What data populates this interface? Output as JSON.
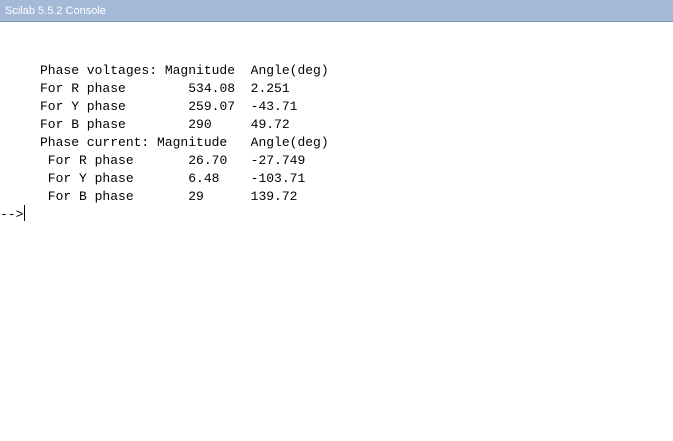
{
  "window": {
    "title": "Scilab 5.5.2 Console"
  },
  "console": {
    "lines": [
      [
        "Phase voltages: Magnitude",
        "  Angle(deg)"
      ],
      [
        "For R phase",
        "        534.08",
        "  2.251"
      ],
      [
        "For Y phase",
        "        259.07",
        "  -43.71"
      ],
      [
        "For B phase",
        "        290",
        "     49.72"
      ],
      [
        "Phase current: Magnitude",
        "   Angle(deg)"
      ],
      [
        " For R phase",
        "       26.70",
        "   -27.749"
      ],
      [
        " For Y phase",
        "       6.48",
        "    -103.71"
      ],
      [
        " For B phase",
        "       29",
        "      139.72"
      ]
    ],
    "prompt": "-->"
  }
}
